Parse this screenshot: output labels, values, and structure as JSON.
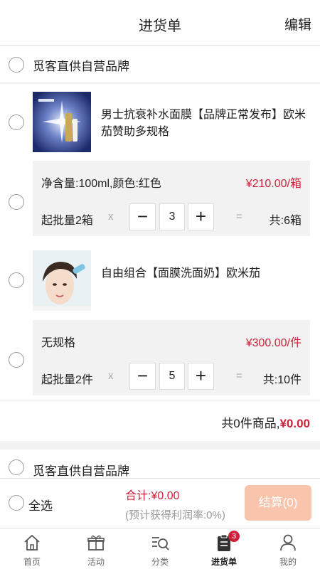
{
  "header": {
    "title": "进货单",
    "edit_label": "编辑"
  },
  "stores": [
    {
      "name": "觅客直供自营品牌"
    },
    {
      "name": "觅客直供自营品牌"
    }
  ],
  "products": [
    {
      "name": "男士抗衰补水面膜【品牌正常发布】欧米茄赞助多规格",
      "thumb_icon": "mask-product-photo",
      "spec": {
        "text": "净含量:100ml,颜色:红色",
        "price": "¥210.00/箱",
        "moq": "起批量2箱",
        "times": "x",
        "qty": "3",
        "eq": "=",
        "total": "共:6箱"
      }
    },
    {
      "name": "自由组合【面膜洗面奶】欧米茄",
      "thumb_icon": "woman-face-photo",
      "spec": {
        "text": "无规格",
        "price": "¥300.00/件",
        "moq": "起批量2件",
        "times": "x",
        "qty": "5",
        "eq": "=",
        "total": "共:10件"
      }
    }
  ],
  "subtotal": {
    "label": "共0件商品,",
    "amount": "¥0.00"
  },
  "bottom": {
    "select_all": "全选",
    "sum": "合计:¥0.00",
    "profit": "(预计获得利润率:0%)",
    "checkout": "结算(0)"
  },
  "tabs": [
    {
      "label": "首页",
      "icon": "home-icon"
    },
    {
      "label": "活动",
      "icon": "gift-icon"
    },
    {
      "label": "分类",
      "icon": "category-search-icon"
    },
    {
      "label": "进货单",
      "icon": "order-list-icon",
      "badge": "3",
      "active": true
    },
    {
      "label": "我的",
      "icon": "user-icon"
    }
  ],
  "colors": {
    "accent": "#d0213a",
    "checkout_bg": "#f8c4ac",
    "spec_bg": "#f2f2f2"
  }
}
